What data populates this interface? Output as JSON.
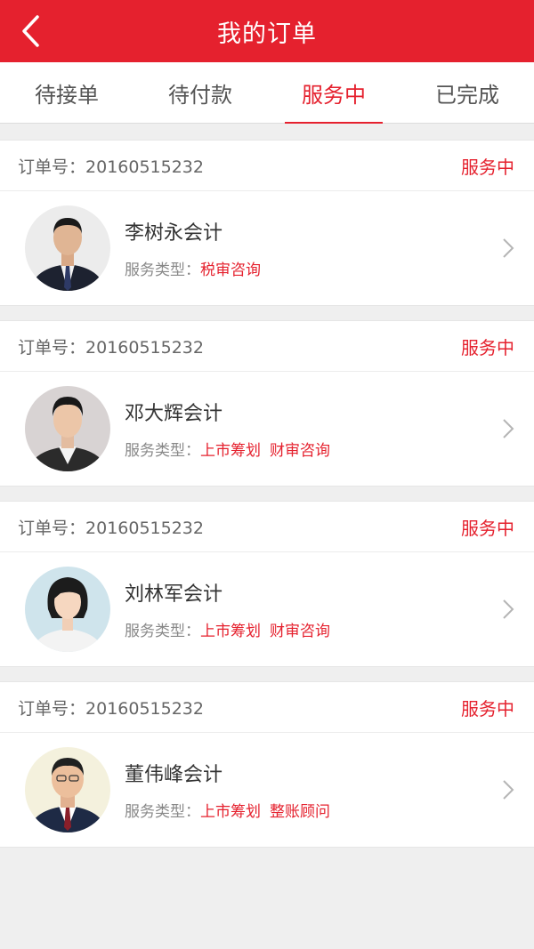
{
  "header": {
    "title": "我的订单"
  },
  "tabs": [
    {
      "label": "待接单",
      "active": false
    },
    {
      "label": "待付款",
      "active": false
    },
    {
      "label": "服务中",
      "active": true
    },
    {
      "label": "已完成",
      "active": false
    }
  ],
  "orders": [
    {
      "order_label": "订单号：",
      "order_no": "20160515232",
      "status": "服务中",
      "name": "李树永会计",
      "service_label": "服务类型：",
      "services": [
        "税审咨询"
      ]
    },
    {
      "order_label": "订单号：",
      "order_no": "20160515232",
      "status": "服务中",
      "name": "邓大辉会计",
      "service_label": "服务类型：",
      "services": [
        "上市筹划",
        "财审咨询"
      ]
    },
    {
      "order_label": "订单号：",
      "order_no": "20160515232",
      "status": "服务中",
      "name": "刘林军会计",
      "service_label": "服务类型：",
      "services": [
        "上市筹划",
        "财审咨询"
      ]
    },
    {
      "order_label": "订单号：",
      "order_no": "20160515232",
      "status": "服务中",
      "name": "董伟峰会计",
      "service_label": "服务类型：",
      "services": [
        "上市筹划",
        "整账顾问"
      ]
    }
  ],
  "colors": {
    "brand": "#e5212e",
    "background": "#efefef"
  },
  "icons": {
    "back": "chevron-left-icon",
    "row_arrow": "chevron-right-icon"
  }
}
